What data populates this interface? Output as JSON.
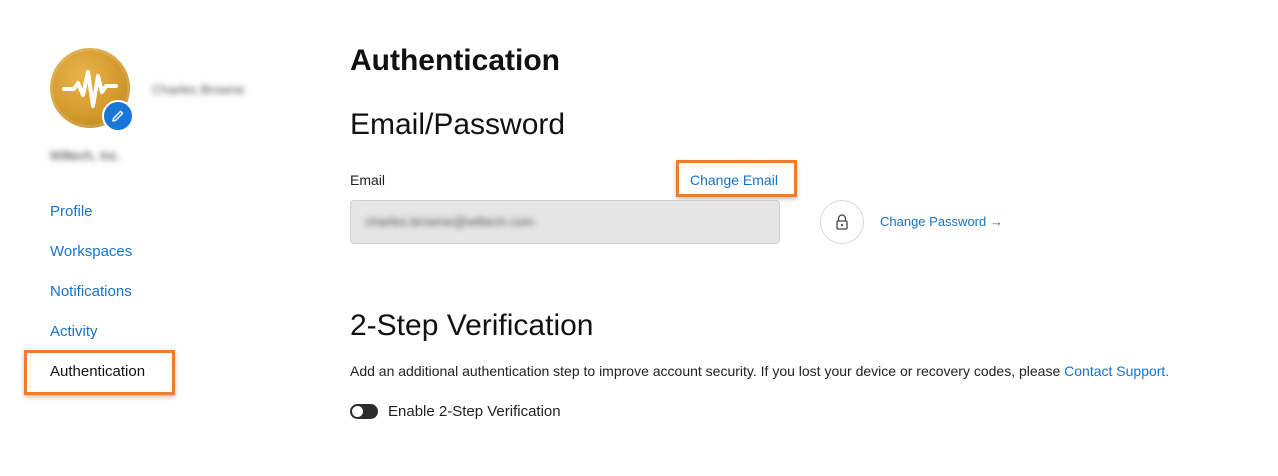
{
  "user": {
    "name": "Charles Browne",
    "organization": "Wiltech, Inc."
  },
  "sidebar": {
    "items": [
      {
        "label": "Profile"
      },
      {
        "label": "Workspaces"
      },
      {
        "label": "Notifications"
      },
      {
        "label": "Activity"
      },
      {
        "label": "Authentication"
      }
    ],
    "active": "Authentication"
  },
  "main": {
    "title": "Authentication",
    "email_section": {
      "heading": "Email/Password",
      "email_label": "Email",
      "change_email": "Change Email",
      "email_value": "charles.browne@wiltech.com",
      "change_password": "Change Password →"
    },
    "two_step": {
      "heading": "2-Step Verification",
      "description": "Add an additional authentication step to improve account security. If you lost your device or recovery codes, please ",
      "contact_link": "Contact Support",
      "description_end": ".",
      "toggle_label": "Enable 2-Step Verification",
      "enabled": false
    }
  },
  "colors": {
    "link": "#1673c8",
    "highlight": "#ef7d2d",
    "avatar": "#d39a2c",
    "badge": "#1877d9"
  },
  "icons": [
    "waveform-icon",
    "pencil-icon",
    "lock-icon"
  ]
}
